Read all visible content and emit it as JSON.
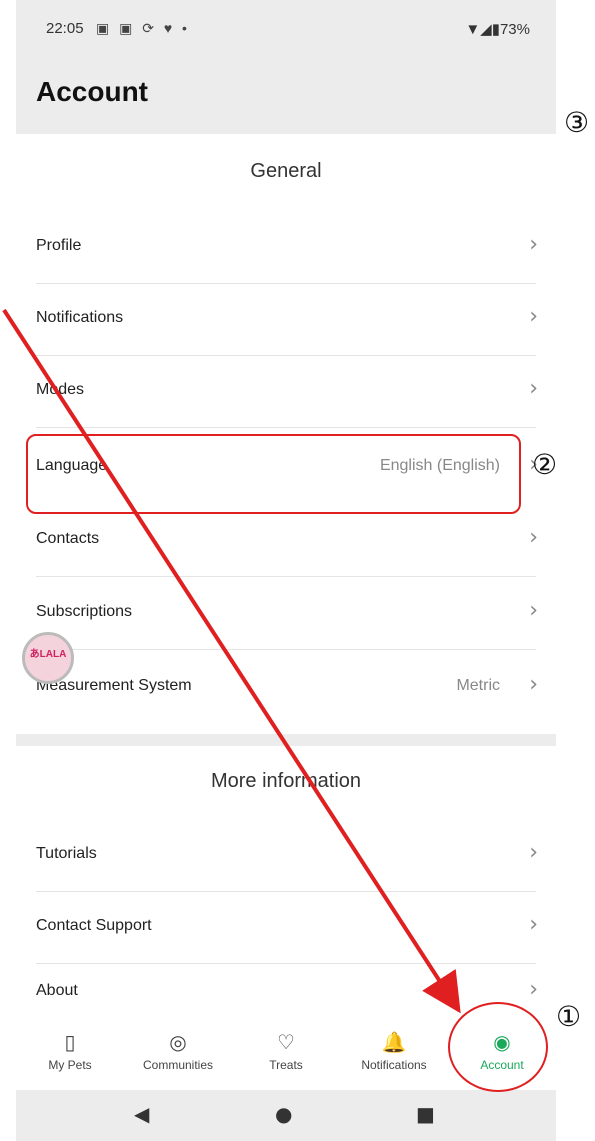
{
  "status_bar": {
    "time": "22:05",
    "icons": "▣ ▣ ⟳ ♥ •",
    "right": "▼◢▮73%"
  },
  "header": {
    "title": "Account"
  },
  "general": {
    "title": "General",
    "items": [
      {
        "label": "Profile",
        "value": ""
      },
      {
        "label": "Notifications",
        "value": ""
      },
      {
        "label": "Modes",
        "value": ""
      },
      {
        "label": "Language",
        "value": "English (English)"
      },
      {
        "label": "Contacts",
        "value": ""
      },
      {
        "label": "Subscriptions",
        "value": ""
      },
      {
        "label": "Measurement System",
        "value": "Metric"
      }
    ]
  },
  "more_info": {
    "title": "More information",
    "items": [
      {
        "label": "Tutorials",
        "value": ""
      },
      {
        "label": "Contact Support",
        "value": ""
      },
      {
        "label": "About",
        "value": ""
      }
    ]
  },
  "chevron": "›",
  "badge_text": "あLALA",
  "bottom_nav": [
    {
      "label": "My Pets",
      "icon": "▯"
    },
    {
      "label": "Communities",
      "icon": "◎"
    },
    {
      "label": "Treats",
      "icon": "♡"
    },
    {
      "label": "Notifications",
      "icon": "🔔"
    },
    {
      "label": "Account",
      "icon": "◉"
    }
  ],
  "system_nav": {
    "back": "◀",
    "home": "●",
    "recents": "■"
  },
  "annotations": {
    "one": "①",
    "two": "②",
    "three": "③"
  },
  "colors": {
    "accent": "#1aa85a",
    "annotation": "#e02020"
  }
}
